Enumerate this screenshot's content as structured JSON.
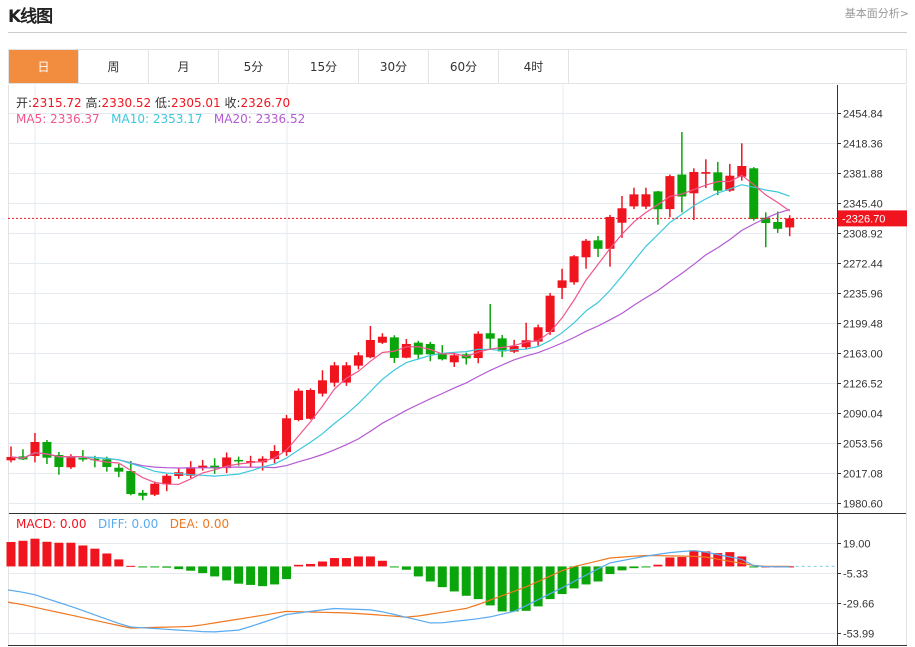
{
  "header": {
    "title": "K线图",
    "link": "基本面分析>"
  },
  "tabs": [
    {
      "label": "日",
      "active": true
    },
    {
      "label": "周"
    },
    {
      "label": "月"
    },
    {
      "label": "5分"
    },
    {
      "label": "15分"
    },
    {
      "label": "30分"
    },
    {
      "label": "60分"
    },
    {
      "label": "4时"
    }
  ],
  "ohlc_info": {
    "open_label": "开:",
    "open": "2315.72",
    "high_label": "高:",
    "high": "2330.52",
    "low_label": "低:",
    "low": "2305.01",
    "close_label": "收:",
    "close": "2326.70"
  },
  "ma_info": {
    "ma5": "MA5: 2336.37",
    "ma10": "MA10: 2353.17",
    "ma20": "MA20: 2336.52"
  },
  "macd_info": {
    "macd": "MACD: 0.00",
    "diff": "DIFF: 0.00",
    "dea": "DEA: 0.00"
  },
  "colors": {
    "up": "#f0141e",
    "down": "#0aa50a",
    "ma5": "#f0558c",
    "ma10": "#3cc8dc",
    "ma20": "#b45ad2",
    "diff": "#5aaaf0",
    "dea": "#f07820",
    "tab_active": "#f28c3f"
  },
  "chart_data": {
    "type": "candlestick",
    "price_axis_ticks": [
      "2454.84",
      "2418.36",
      "2381.88",
      "2345.40",
      "2308.92",
      "2272.44",
      "2235.96",
      "2199.48",
      "2163.00",
      "2126.52",
      "2090.04",
      "2053.56",
      "2017.08",
      "1980.60"
    ],
    "price_range": [
      1980.6,
      2454.84
    ],
    "current_price": "2326.70",
    "candles": [
      [
        2032.5,
        2049.4,
        2030.0,
        2036.6
      ],
      [
        2037.3,
        2046.0,
        2032.9,
        2033.6
      ],
      [
        2037.8,
        2065.7,
        2030.0,
        2054.8
      ],
      [
        2054.8,
        2057.2,
        2028.0,
        2035.7
      ],
      [
        2039.0,
        2042.6,
        2015.0,
        2024.4
      ],
      [
        2024.0,
        2039.9,
        2022.0,
        2036.0
      ],
      [
        2035.3,
        2045.0,
        2031.0,
        2034.0
      ],
      [
        2034.4,
        2038.0,
        2024.0,
        2032.8
      ],
      [
        2033.7,
        2037.0,
        2018.7,
        2024.4
      ],
      [
        2023.5,
        2028.0,
        2012.0,
        2018.7
      ],
      [
        2019.5,
        2031.7,
        1990.0,
        1991.5
      ],
      [
        1993.0,
        1996.4,
        1984.0,
        1989.5
      ],
      [
        1990.7,
        2006.6,
        1989.0,
        2004.0
      ],
      [
        2003.3,
        2015.9,
        1995.0,
        2013.8
      ],
      [
        2013.5,
        2023.0,
        2010.0,
        2018.0
      ],
      [
        2013.8,
        2031.5,
        2011.0,
        2024.0
      ],
      [
        2023.0,
        2033.0,
        2020.0,
        2026.0
      ],
      [
        2026.0,
        2035.0,
        2016.0,
        2023.0
      ],
      [
        2023.0,
        2042.0,
        2017.0,
        2036.0
      ],
      [
        2033.0,
        2037.0,
        2026.0,
        2031.3
      ],
      [
        2030.0,
        2038.0,
        2024.0,
        2031.5
      ],
      [
        2030.0,
        2037.5,
        2020.0,
        2034.5
      ],
      [
        2034.0,
        2051.0,
        2029.0,
        2043.8
      ],
      [
        2042.5,
        2087.7,
        2038.0,
        2083.6
      ],
      [
        2081.5,
        2120.0,
        2080.0,
        2117.2
      ],
      [
        2083.0,
        2120.0,
        2082.0,
        2118.0
      ],
      [
        2113.6,
        2142.0,
        2110.0,
        2129.8
      ],
      [
        2126.9,
        2152.0,
        2122.0,
        2148.0
      ],
      [
        2127.0,
        2152.0,
        2123.0,
        2148.0
      ],
      [
        2147.6,
        2164.0,
        2143.0,
        2160.2
      ],
      [
        2157.8,
        2195.8,
        2156.6,
        2178.8
      ],
      [
        2175.5,
        2187.0,
        2174.0,
        2182.8
      ],
      [
        2182.0,
        2184.6,
        2151.0,
        2157.0
      ],
      [
        2157.3,
        2180.0,
        2156.6,
        2174.0
      ],
      [
        2175.6,
        2177.8,
        2155.0,
        2161.0
      ],
      [
        2174.0,
        2176.6,
        2153.0,
        2161.4
      ],
      [
        2163.0,
        2172.6,
        2154.0,
        2155.3
      ],
      [
        2151.7,
        2163.4,
        2146.0,
        2160.2
      ],
      [
        2161.4,
        2163.4,
        2149.0,
        2156.5
      ],
      [
        2156.9,
        2189.4,
        2150.5,
        2186.5
      ],
      [
        2187.0,
        2222.6,
        2166.6,
        2180.4
      ],
      [
        2180.8,
        2185.0,
        2158.0,
        2165.0
      ],
      [
        2164.6,
        2179.0,
        2163.0,
        2171.5
      ],
      [
        2170.0,
        2199.8,
        2167.5,
        2178.5
      ],
      [
        2176.8,
        2197.5,
        2172.0,
        2194.3
      ],
      [
        2188.5,
        2236.0,
        2185.0,
        2232.7
      ],
      [
        2242.2,
        2265.5,
        2228.7,
        2251.3
      ],
      [
        2249.0,
        2282.0,
        2246.0,
        2280.6
      ],
      [
        2279.4,
        2301.6,
        2265.5,
        2299.5
      ],
      [
        2300.0,
        2305.3,
        2279.7,
        2289.7
      ],
      [
        2289.7,
        2330.9,
        2268.0,
        2328.4
      ],
      [
        2321.4,
        2353.9,
        2303.0,
        2339.0
      ],
      [
        2341.3,
        2364.0,
        2338.0,
        2355.9
      ],
      [
        2341.0,
        2364.0,
        2338.0,
        2356.0
      ],
      [
        2359.5,
        2360.0,
        2319.0,
        2337.8
      ],
      [
        2338.0,
        2380.0,
        2328.0,
        2378.1
      ],
      [
        2380.0,
        2431.7,
        2334.0,
        2353.3
      ],
      [
        2357.2,
        2387.6,
        2324.7,
        2383.1
      ],
      [
        2381.0,
        2398.5,
        2363.6,
        2383.0
      ],
      [
        2382.7,
        2395.4,
        2355.0,
        2360.4
      ],
      [
        2360.4,
        2393.0,
        2359.0,
        2378.6
      ],
      [
        2377.4,
        2418.0,
        2372.5,
        2390.4
      ],
      [
        2387.6,
        2389.0,
        2324.0,
        2326.0
      ],
      [
        2327.5,
        2334.0,
        2291.6,
        2321.0
      ],
      [
        2322.3,
        2335.0,
        2309.0,
        2314.0
      ],
      [
        2315.72,
        2330.52,
        2305.01,
        2326.7
      ]
    ],
    "macd_axis_ticks": [
      "19.00",
      "-5.33",
      "-29.66",
      "-53.99"
    ],
    "macd_hist": [
      19.8,
      20.8,
      22.5,
      20.0,
      19.2,
      19.2,
      17.0,
      14.4,
      10.5,
      5.7,
      0.5,
      -0.3,
      -0.5,
      -1.0,
      -2.2,
      -3.5,
      -5.4,
      -8.1,
      -11.3,
      -14.0,
      -15.0,
      -16.0,
      -14.6,
      -10.3,
      1.3,
      2.0,
      4.0,
      6.8,
      6.8,
      8.1,
      8.1,
      4.6,
      -0.5,
      -2.7,
      -8.1,
      -12.2,
      -16.8,
      -20.3,
      -23.8,
      -26.5,
      -31.6,
      -36.5,
      -36.5,
      -36.0,
      -32.4,
      -26.5,
      -22.4,
      -17.8,
      -14.6,
      -12.2,
      -6.2,
      -3.2,
      -1.4,
      -0.3,
      1.4,
      7.3,
      7.6,
      13.0,
      12.2,
      10.8,
      11.6,
      8.1,
      -0.3,
      0,
      0,
      0
    ],
    "diff_points": [
      [
        0,
        -19
      ],
      [
        2,
        -23
      ],
      [
        5,
        -32.4
      ],
      [
        9.8,
        -49
      ],
      [
        16.7,
        -53.3
      ],
      [
        19.1,
        -51.6
      ],
      [
        23,
        -39
      ],
      [
        26.9,
        -34.1
      ],
      [
        30.4,
        -35.4
      ],
      [
        35.3,
        -46.5
      ],
      [
        39.7,
        -41.6
      ],
      [
        42.1,
        -36.2
      ],
      [
        46,
        -17.3
      ],
      [
        49.9,
        2.7
      ],
      [
        52.8,
        8.1
      ],
      [
        55.3,
        11.6
      ],
      [
        57.3,
        13
      ],
      [
        61.2,
        5.4
      ],
      [
        62.1,
        0
      ],
      [
        65,
        -0.5
      ]
    ],
    "dea_points": [
      [
        0,
        -28.9
      ],
      [
        10,
        -50
      ],
      [
        15.2,
        -48.6
      ],
      [
        23,
        -36.5
      ],
      [
        28.4,
        -37.8
      ],
      [
        33.3,
        -41.3
      ],
      [
        38.2,
        -33.7
      ],
      [
        43.1,
        -16.2
      ],
      [
        46.5,
        -1.3
      ],
      [
        50,
        6.8
      ],
      [
        52.8,
        8.9
      ],
      [
        57.7,
        8.1
      ],
      [
        61.6,
        1.4
      ],
      [
        62.6,
        0
      ],
      [
        65,
        0
      ]
    ]
  }
}
